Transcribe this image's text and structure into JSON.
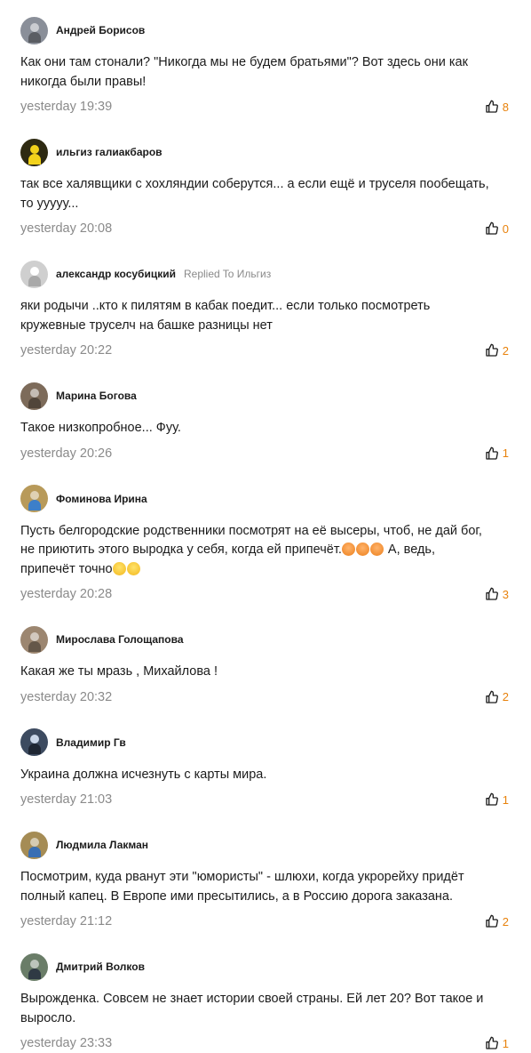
{
  "comments": [
    {
      "author": "Андрей Борисов",
      "replied": "",
      "lines": [
        "Как они там стонали? \"Никогда мы не будем братьями\"? Вот здесь они как никогда были правы!"
      ],
      "time": "yesterday 19:39",
      "likes": "8",
      "avatar_color": "#8a8f99"
    },
    {
      "author": "ильгиз галиакбаров",
      "replied": "",
      "lines": [
        "так все халявщики с хохляндии соберутся... а если ещё и труселя пообещать, то ууууу..."
      ],
      "time": "yesterday 20:08",
      "likes": "0",
      "avatar_color": "#2e2a12"
    },
    {
      "author": "александр косубицкий",
      "replied": "Replied To Ильгиз",
      "lines": [
        "яки родычи ..кто к пилятям в кабак поедит... если только посмотреть кружевные труселч на башке разницы нет"
      ],
      "time": "yesterday 20:22",
      "likes": "2",
      "avatar_color": "#cfcfcf"
    },
    {
      "author": "Марина Богова",
      "replied": "",
      "lines": [
        "Такое низкопробное... Фуу."
      ],
      "time": "yesterday 20:26",
      "likes": "1",
      "avatar_color": "#7d6b5a"
    },
    {
      "author": "Фоминова Ирина",
      "replied": "",
      "lines": [
        "Пусть белгородские родственники посмотрят на её высеры, чтоб, не дай бог, не приютить этого выродка у себя, когда ей припечёт.",
        " А, ведь, припечёт точно"
      ],
      "time": "yesterday 20:28",
      "likes": "3",
      "avatar_color": "#b89a5a"
    },
    {
      "author": "Мирослава Голощапова",
      "replied": "",
      "lines": [
        "Какая же ты мразь , Михайлова !"
      ],
      "time": "yesterday 20:32",
      "likes": "2",
      "avatar_color": "#9c8670"
    },
    {
      "author": "Владимир Гв",
      "replied": "",
      "lines": [
        "Украина должна исчезнуть с карты мира."
      ],
      "time": "yesterday 21:03",
      "likes": "1",
      "avatar_color": "#3d4b60"
    },
    {
      "author": "Людмила Лакман",
      "replied": "",
      "lines": [
        "Посмотрим, куда рванут эти \"юмористы\" - шлюхи, когда укрорейху придёт полный капец. В Европе ими пресытились, а в Россию дорога заказана."
      ],
      "time": "yesterday 21:12",
      "likes": "2",
      "avatar_color": "#a58c55"
    },
    {
      "author": "Дмитрий Волков",
      "replied": "",
      "lines": [
        "Вырожденка. Совсем не знает истории своей страны. Ей лет 20? Вот такое и выросло."
      ],
      "time": "yesterday 23:33",
      "likes": "1",
      "avatar_color": "#6a7d68"
    }
  ],
  "colors": {
    "accent": "#e8820c",
    "muted": "#8a8a8a",
    "text": "#1b1b1b"
  },
  "icons": {
    "like": "thumbs-up-icon",
    "avatar": "user-avatar-icon"
  }
}
